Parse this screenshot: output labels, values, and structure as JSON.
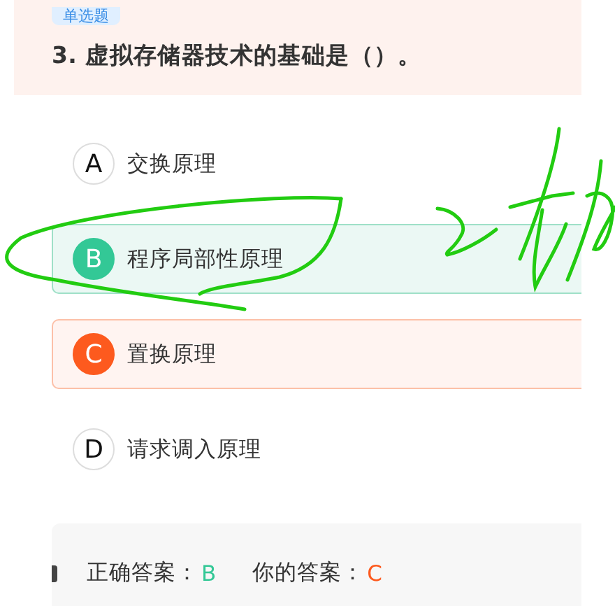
{
  "question": {
    "tag": "单选题",
    "title": "3. 虚拟存储器技术的基础是（）。"
  },
  "options": [
    {
      "letter": "A",
      "text": "交换原理",
      "correct": false,
      "selected": false
    },
    {
      "letter": "B",
      "text": "程序局部性原理",
      "correct": true,
      "selected": false
    },
    {
      "letter": "C",
      "text": "置换原理",
      "correct": false,
      "selected": true
    },
    {
      "letter": "D",
      "text": "请求调入原理",
      "correct": false,
      "selected": false
    }
  ],
  "answer": {
    "correct_label": "正确答案：",
    "correct_value": "B",
    "yours_label": "你的答案：",
    "yours_value": "C"
  }
}
